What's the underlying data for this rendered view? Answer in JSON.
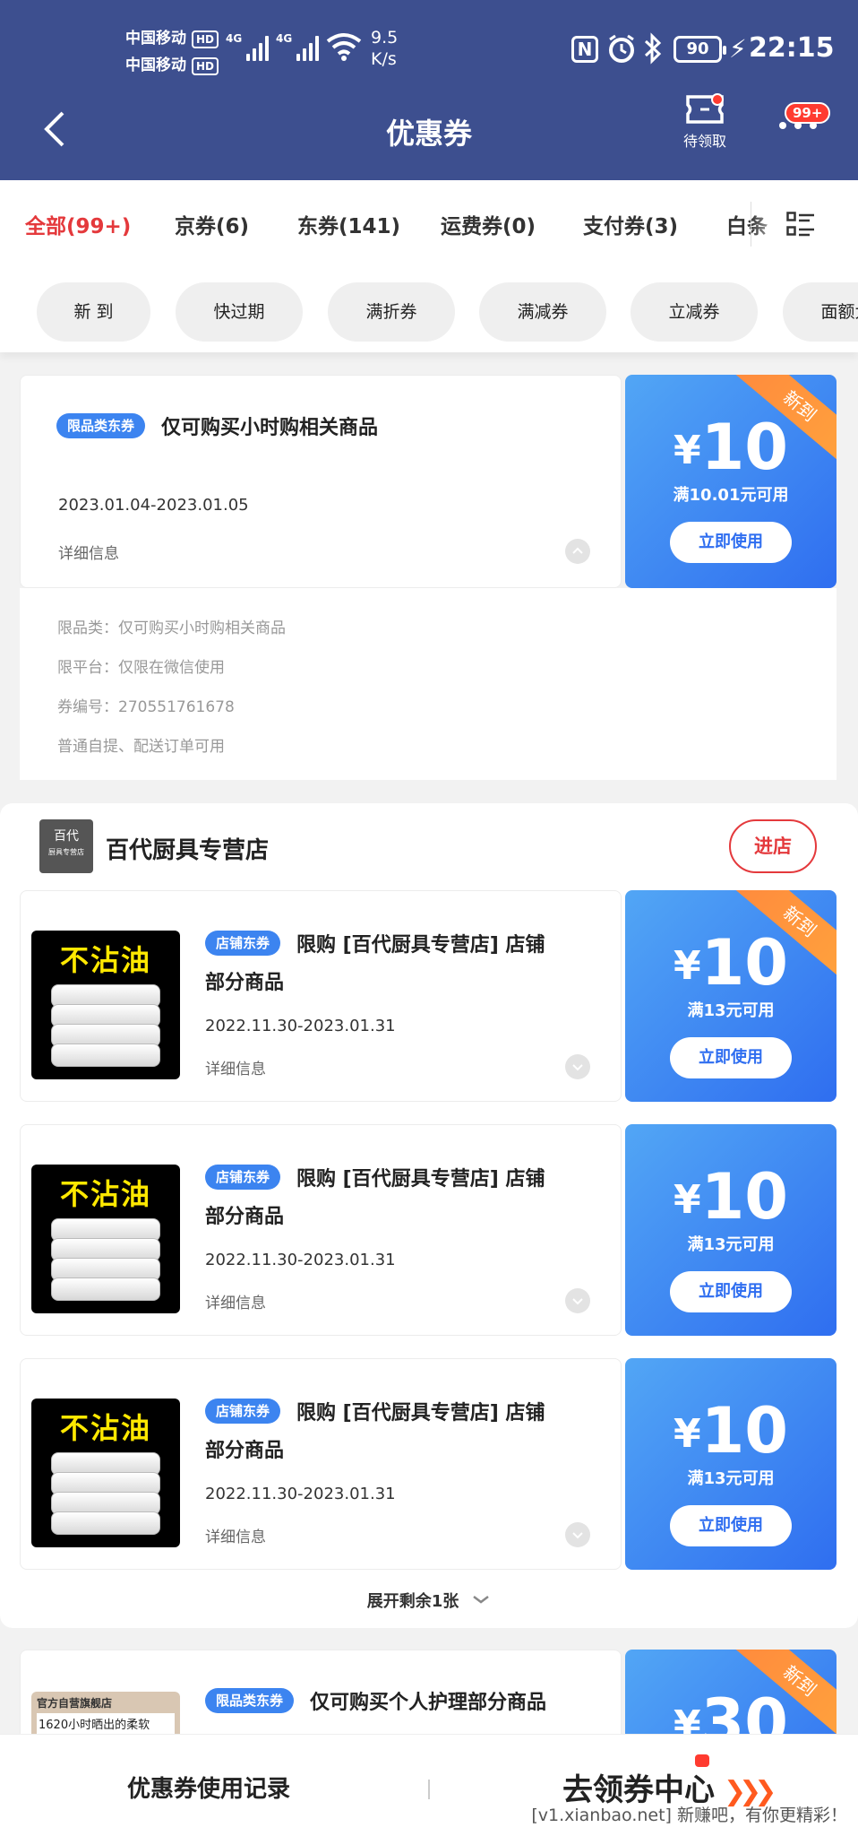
{
  "status_bar": {
    "carrier1": "中国移动",
    "carrier2": "中国移动",
    "hd": "HD",
    "net_type": "4G",
    "speed_value": "9.5",
    "speed_unit": "K/s",
    "nfc": "N",
    "battery": "90",
    "time": "22:15"
  },
  "header": {
    "title": "优惠券",
    "pending_label": "待领取",
    "more_badge": "99+"
  },
  "tabs": [
    "全部(99+)",
    "京券(6)",
    "东券(141)",
    "运费券(0)",
    "支付券(3)",
    "白条"
  ],
  "filters": [
    "新 到",
    "快过期",
    "满折券",
    "满减券",
    "立减券",
    "面额大"
  ],
  "colors": {
    "accent_red": "#e4393c",
    "coupon_blue": "#2f6ef0",
    "header_bg": "#3d4f8f",
    "ribbon": "#ff8a3d"
  },
  "coupon1": {
    "tag": "限品类东券",
    "title": "仅可购买小时购相关商品",
    "date": "2023.01.04-2023.01.05",
    "detail_label": "详细信息",
    "currency": "¥",
    "amount": "10",
    "condition": "满10.01元可用",
    "use_label": "立即使用",
    "ribbon": "新到",
    "details": [
      "限品类：仅可购买小时购相关商品",
      "限平台：仅限在微信使用",
      "券编号：270551761678",
      "普通自提、配送订单可用"
    ]
  },
  "shop": {
    "logo_text": "百代",
    "logo_sub": "厨具专营店",
    "name": "百代厨具专营店",
    "enter_label": "进店",
    "coupons": [
      {
        "tag": "店铺东券",
        "title_line1": "限购 [百代厨具专营店] 店铺",
        "title_line2": "部分商品",
        "date": "2022.11.30-2023.01.31",
        "detail_label": "详细信息",
        "thumb_text": "不沾油",
        "currency": "¥",
        "amount": "10",
        "condition": "满13元可用",
        "use_label": "立即使用",
        "ribbon": "新到"
      },
      {
        "tag": "店铺东券",
        "title_line1": "限购 [百代厨具专营店] 店铺",
        "title_line2": "部分商品",
        "date": "2022.11.30-2023.01.31",
        "detail_label": "详细信息",
        "thumb_text": "不沾油",
        "currency": "¥",
        "amount": "10",
        "condition": "满13元可用",
        "use_label": "立即使用"
      },
      {
        "tag": "店铺东券",
        "title_line1": "限购 [百代厨具专营店] 店铺",
        "title_line2": "部分商品",
        "date": "2022.11.30-2023.01.31",
        "detail_label": "详细信息",
        "thumb_text": "不沾油",
        "currency": "¥",
        "amount": "10",
        "condition": "满13元可用",
        "use_label": "立即使用"
      }
    ],
    "expand_label": "展开剩余1张"
  },
  "coupon_last": {
    "tag": "限品类东券",
    "title": "仅可购买个人护理部分商品",
    "currency": "¥",
    "amount": "30",
    "ribbon": "新到",
    "thumb_caption": "官方自营旗舰店",
    "thumb_line": "1620小时晒出的柔软"
  },
  "bottom_bar": {
    "record_label": "优惠券使用记录",
    "center_label": "去领券中心",
    "arrows": "❯❯❯"
  },
  "watermark": "[v1.xianbao.net] 新赚吧，有你更精彩！"
}
